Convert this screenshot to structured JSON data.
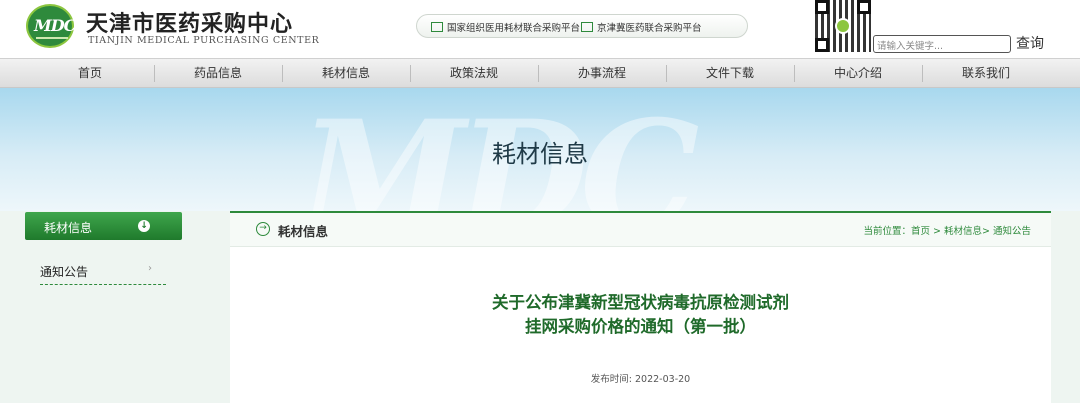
{
  "header": {
    "logo_text": "MDC",
    "site_name": "天津市医药采购中心",
    "site_name_en": "TIANJIN MEDICAL PURCHASING CENTER",
    "platform_links": [
      {
        "label": "国家组织医用耗材联合采购平台",
        "icon": "window-icon"
      },
      {
        "label": "京津冀医药联合采购平台",
        "icon": "window-icon"
      }
    ],
    "search_placeholder": "请输入关键字...",
    "search_button": "查询"
  },
  "nav": {
    "items": [
      "首页",
      "药品信息",
      "耗材信息",
      "政策法规",
      "办事流程",
      "文件下载",
      "中心介绍",
      "联系我们"
    ]
  },
  "banner": {
    "title": "耗材信息",
    "watermark": "MDC"
  },
  "sidebar": {
    "header_label": "耗材信息",
    "header_icon": "arrow-down-circle-icon",
    "items": [
      {
        "label": "通知公告",
        "icon": "chevron-right-icon"
      }
    ]
  },
  "main": {
    "section_title": "耗材信息",
    "breadcrumb": "当前位置：首页 > 耗材信息> 通知公告",
    "article_title_line1": "关于公布津冀新型冠状病毒抗原检测试剂",
    "article_title_line2": "挂网采购价格的通知（第一批）",
    "publish_date": "发布时间: 2022-03-20"
  },
  "colors": {
    "brand_green": "#2e8a3c",
    "banner_blue": "#a8d8ee"
  }
}
